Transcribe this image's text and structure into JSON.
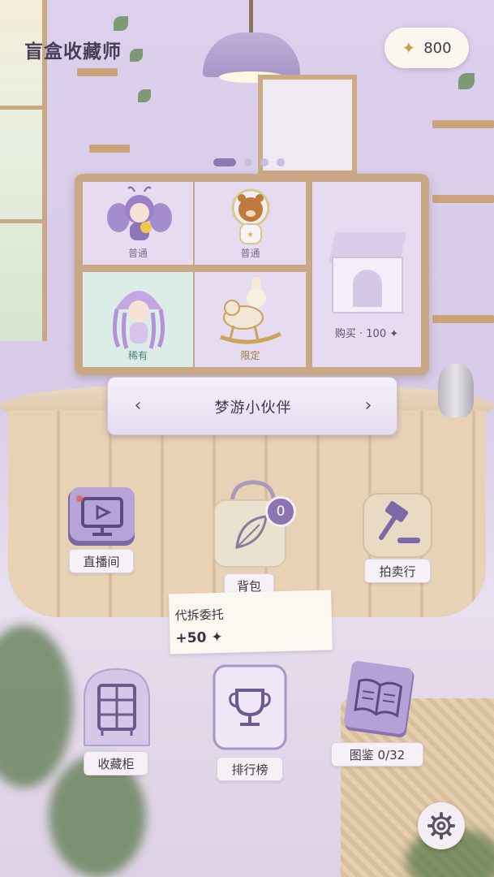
{
  "app": {
    "title": "盲盒收藏师"
  },
  "currency": {
    "amount": "800",
    "icon": "sparkle-star-icon"
  },
  "carousel": {
    "page_count": 4,
    "active_index": 0
  },
  "showcase": {
    "figures": [
      {
        "name": "moth-girl-figure",
        "rarity": "普通"
      },
      {
        "name": "astronaut-bear-figure",
        "rarity": "普通"
      },
      {
        "name": "jellyfish-girl-figure",
        "rarity": "稀有"
      },
      {
        "name": "bunny-rocking-horse-figure",
        "rarity": "限定"
      }
    ],
    "buy_label": "购买 · 100 ✦"
  },
  "series": {
    "name": "梦游小伙伴",
    "prev": "‹",
    "next": "›"
  },
  "menu": {
    "live": "直播间",
    "bag": "背包",
    "bag_count": "0",
    "auction": "拍卖行",
    "cabinet": "收藏柜",
    "ranking": "排行榜",
    "guide": "图鉴 0/32"
  },
  "commission": {
    "title": "代拆委托",
    "reward": "+50 ✦"
  },
  "colors": {
    "accent": "#8b74b0",
    "wood": "#c9a985",
    "panel": "#e6dbf0"
  }
}
